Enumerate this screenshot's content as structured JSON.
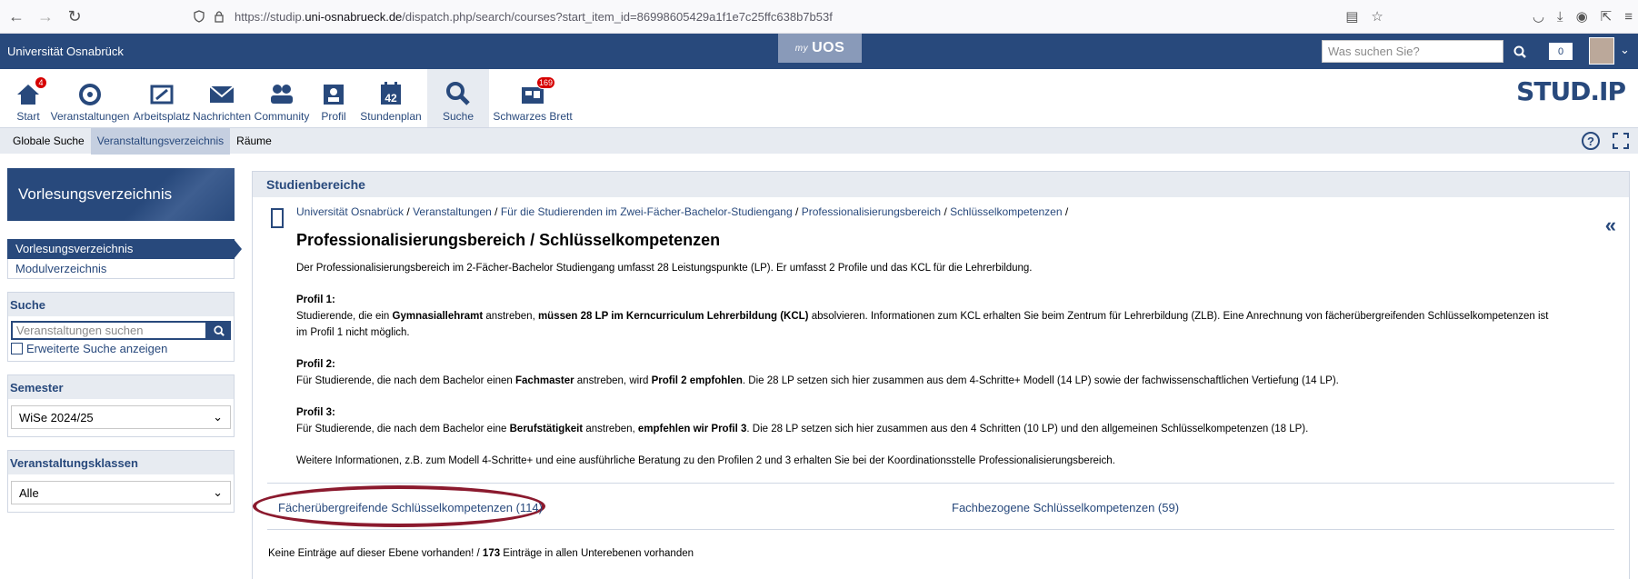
{
  "browser": {
    "url_prefix": "https://studip.",
    "url_domain": "uni-osnabrueck.de",
    "url_path": "/dispatch.php/search/courses?start_item_id=86998605429a1f1e7c25ffc638b7b53f"
  },
  "header": {
    "university": "Universität Osnabrück",
    "myuos_prefix": "my",
    "myuos": "UOS",
    "search_placeholder": "Was suchen Sie?",
    "notification_count": "0"
  },
  "nav": {
    "items": [
      {
        "label": "Start",
        "badge": "4"
      },
      {
        "label": "Veranstaltungen"
      },
      {
        "label": "Arbeitsplatz"
      },
      {
        "label": "Nachrichten"
      },
      {
        "label": "Community"
      },
      {
        "label": "Profil"
      },
      {
        "label": "Stundenplan",
        "icon_text": "42"
      },
      {
        "label": "Suche"
      },
      {
        "label": "Schwarzes Brett",
        "badge": "169"
      }
    ],
    "logo": "STUD.IP"
  },
  "subnav": {
    "tabs": [
      "Globale Suche",
      "Veranstaltungsverzeichnis",
      "Räume"
    ],
    "help": "?"
  },
  "sidebar": {
    "title": "Vorlesungsverzeichnis",
    "nav": [
      "Vorlesungsverzeichnis",
      "Modulverzeichnis"
    ],
    "search_title": "Suche",
    "search_placeholder": "Veranstaltungen suchen",
    "advanced_search": "Erweiterte Suche anzeigen",
    "semester_title": "Semester",
    "semester_value": "WiSe 2024/25",
    "classes_title": "Veranstaltungsklassen",
    "classes_value": "Alle"
  },
  "main": {
    "heading": "Studienbereiche",
    "breadcrumbs": [
      "Universität Osnabrück",
      "Veranstaltungen",
      "Für die Studierenden im Zwei-Fächer-Bachelor-Studiengang",
      "Professionalisierungsbereich",
      "Schlüsselkompetenzen"
    ],
    "title": "Professionalisierungsbereich / Schlüsselkompetenzen",
    "intro": "Der Professionalisierungsbereich im 2-Fächer-Bachelor Studiengang umfasst 28 Leistungspunkte (LP). Er umfasst 2 Profile und das KCL für die Lehrerbildung.",
    "profil1_label": "Profil 1:",
    "profil1_a": "Studierende, die ein ",
    "profil1_b": "Gymnasiallehramt",
    "profil1_c": " anstreben, ",
    "profil1_d": "müssen 28 LP im Kerncurriculum Lehrerbildung (KCL)",
    "profil1_e": " absolvieren. Informationen zum KCL erhalten Sie beim Zentrum für Lehrerbildung (ZLB). Eine Anrechnung von fächerübergreifenden Schlüsselkompetenzen ist im Profil 1 nicht möglich.",
    "profil2_label": "Profil 2:",
    "profil2_a": "Für Studierende, die nach dem Bachelor einen ",
    "profil2_b": "Fachmaster",
    "profil2_c": " anstreben, wird ",
    "profil2_d": "Profil 2 empfohlen",
    "profil2_e": ". Die 28 LP setzen sich hier zusammen aus dem 4-Schritte+ Modell (14 LP) sowie der fachwissenschaftlichen Vertiefung (14 LP).",
    "profil3_label": "Profil 3:",
    "profil3_a": "Für Studierende, die nach dem Bachelor eine ",
    "profil3_b": "Berufstätigkeit",
    "profil3_c": " anstreben, ",
    "profil3_d": "empfehlen wir Profil 3",
    "profil3_e": ". Die 28 LP setzen sich hier zusammen aus den 4 Schritten (10 LP) und den allgemeinen Schlüsselkompetenzen (18 LP).",
    "more_info": "Weitere Informationen, z.B. zum Modell 4-Schritte+ und eine ausführliche Beratung zu den Profilen 2 und 3 erhalten Sie bei der Koordinationsstelle Professionalisierungsbereich.",
    "categories": [
      "Fächerübergreifende Schlüsselkompetenzen (114)",
      "Fachbezogene Schlüsselkompetenzen (59)"
    ],
    "footer_a": "Keine Einträge auf dieser Ebene vorhanden!  /  ",
    "footer_count": "173",
    "footer_b": " Einträge in allen Unterebenen vorhanden"
  }
}
